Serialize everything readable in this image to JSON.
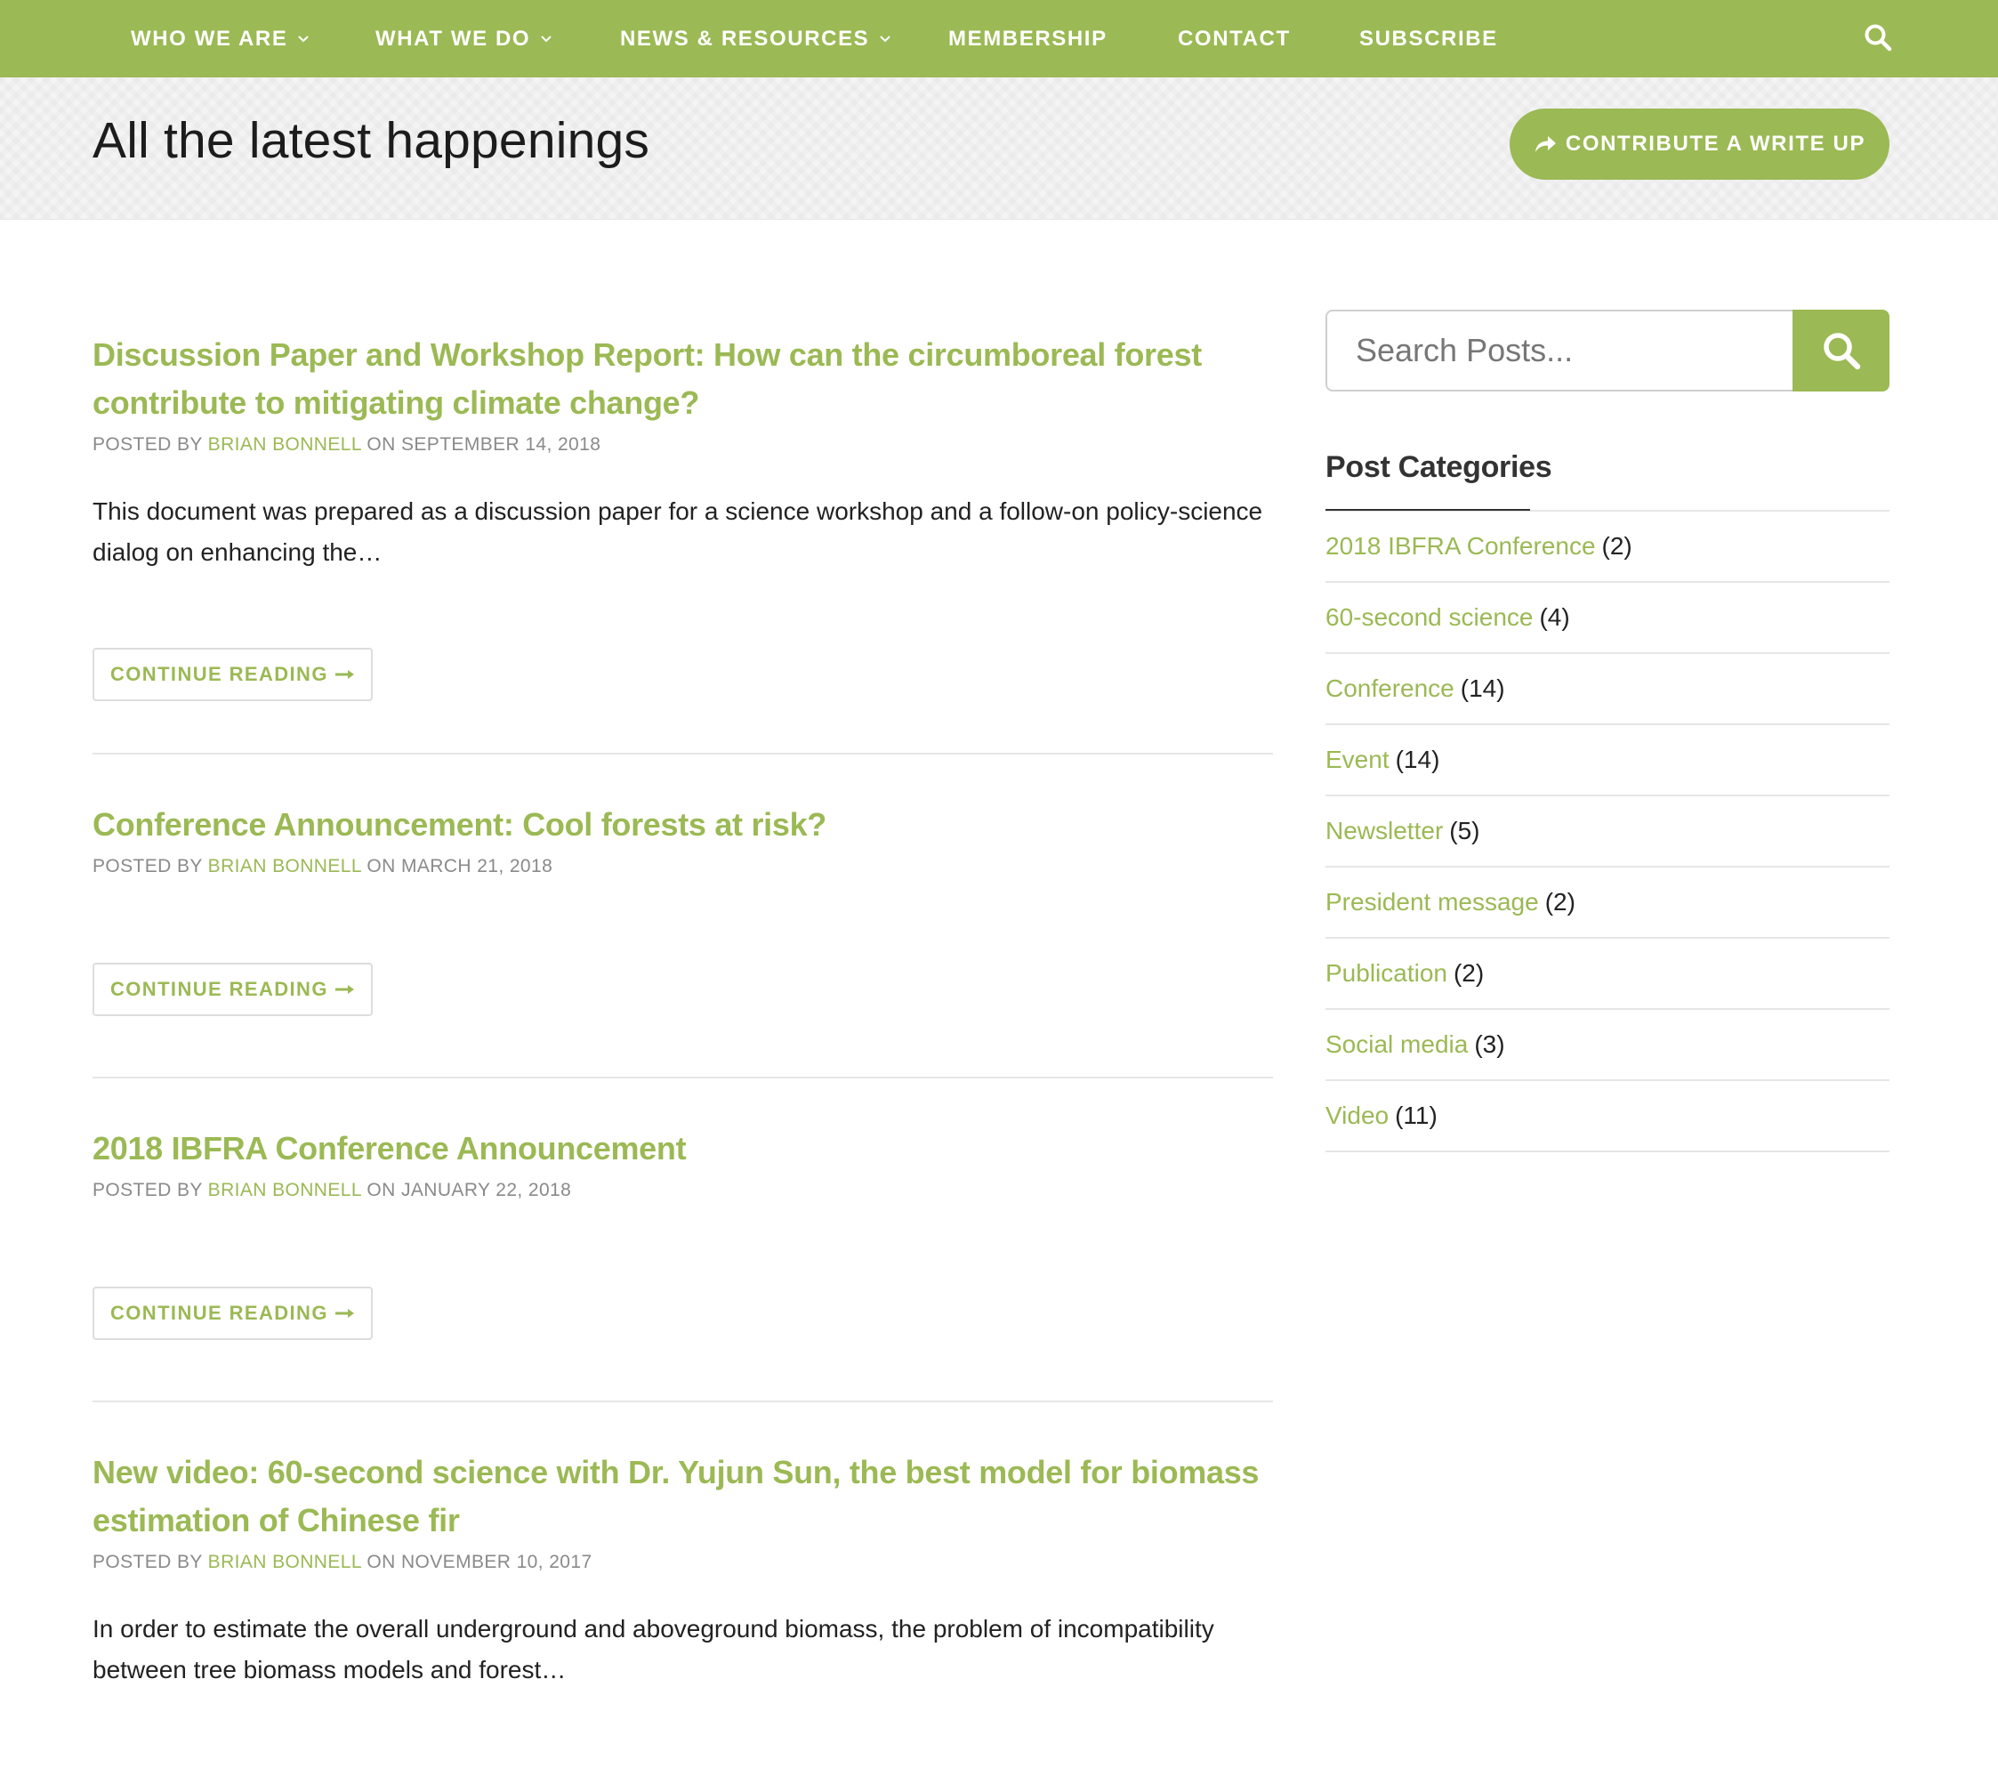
{
  "nav": {
    "items": [
      {
        "label": "WHO WE ARE",
        "dropdown": true
      },
      {
        "label": "WHAT WE DO",
        "dropdown": true
      },
      {
        "label": "NEWS & RESOURCES",
        "dropdown": true
      },
      {
        "label": "MEMBERSHIP",
        "dropdown": false
      },
      {
        "label": "CONTACT",
        "dropdown": false
      },
      {
        "label": "SUBSCRIBE",
        "dropdown": false
      }
    ],
    "search_icon": "search-icon"
  },
  "banner": {
    "title": "All the latest happenings",
    "contribute_label": "CONTRIBUTE A WRITE UP",
    "contribute_icon": "share-arrow-icon"
  },
  "posts": [
    {
      "title": "Discussion Paper and Workshop Report: How can the circumboreal forest contribute to mitigating climate change?",
      "posted_by": "POSTED BY",
      "author": "BRIAN BONNELL",
      "on": "ON",
      "date": "SEPTEMBER 14, 2018",
      "excerpt": "This document was prepared as a discussion paper for a science workshop and a follow-on policy-science dialog on enhancing the…",
      "continue_label": "CONTINUE READING"
    },
    {
      "title": "Conference Announcement: Cool forests at risk?",
      "posted_by": "POSTED BY",
      "author": "BRIAN BONNELL",
      "on": "ON",
      "date": "MARCH 21, 2018",
      "continue_label": "CONTINUE READING"
    },
    {
      "title": "2018 IBFRA Conference Announcement",
      "posted_by": "POSTED BY",
      "author": "BRIAN BONNELL",
      "on": "ON",
      "date": "JANUARY 22, 2018",
      "continue_label": "CONTINUE READING"
    },
    {
      "title": "New video: 60-second science with Dr. Yujun Sun, the best model for biomass estimation of Chinese fir",
      "posted_by": "POSTED BY",
      "author": "BRIAN BONNELL",
      "on": "ON",
      "date": "NOVEMBER 10, 2017",
      "excerpt": "In order to estimate the overall underground and aboveground biomass, the problem of incompatibility between tree biomass models and forest…"
    }
  ],
  "sidebar": {
    "search_placeholder": "Search Posts...",
    "categories_heading": "Post Categories",
    "categories": [
      {
        "name": "2018 IBFRA Conference",
        "count": "(2)"
      },
      {
        "name": "60-second science",
        "count": "(4)"
      },
      {
        "name": "Conference",
        "count": "(14)"
      },
      {
        "name": "Event",
        "count": "(14)"
      },
      {
        "name": "Newsletter",
        "count": "(5)"
      },
      {
        "name": "President message",
        "count": "(2)"
      },
      {
        "name": "Publication",
        "count": "(2)"
      },
      {
        "name": "Social media",
        "count": "(3)"
      },
      {
        "name": "Video",
        "count": "(11)"
      }
    ]
  },
  "colors": {
    "brand_green": "#9bb954",
    "text_dark": "#222222",
    "meta_gray": "#8a8a8a",
    "divider": "#e6e6e6"
  }
}
